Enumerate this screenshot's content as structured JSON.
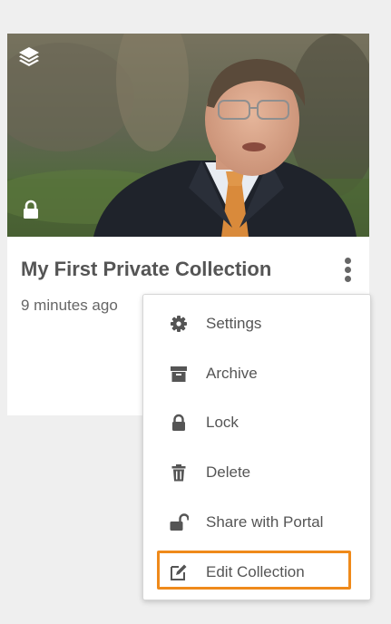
{
  "card": {
    "title": "My First Private Collection",
    "time": "9 minutes ago",
    "icons": {
      "collection": "layers-icon",
      "privacy": "lock-icon",
      "more": "more-vertical-icon"
    }
  },
  "menu": {
    "items": [
      {
        "label": "Settings",
        "icon": "gear-icon"
      },
      {
        "label": "Archive",
        "icon": "archive-icon"
      },
      {
        "label": "Lock",
        "icon": "lock-icon"
      },
      {
        "label": "Delete",
        "icon": "trash-icon"
      },
      {
        "label": "Share with Portal",
        "icon": "unlock-icon"
      },
      {
        "label": "Edit Collection",
        "icon": "edit-icon",
        "highlighted": true
      }
    ]
  },
  "colors": {
    "highlight": "#ef8a1b",
    "title": "#555555",
    "text": "#666666",
    "background": "#efefef"
  }
}
